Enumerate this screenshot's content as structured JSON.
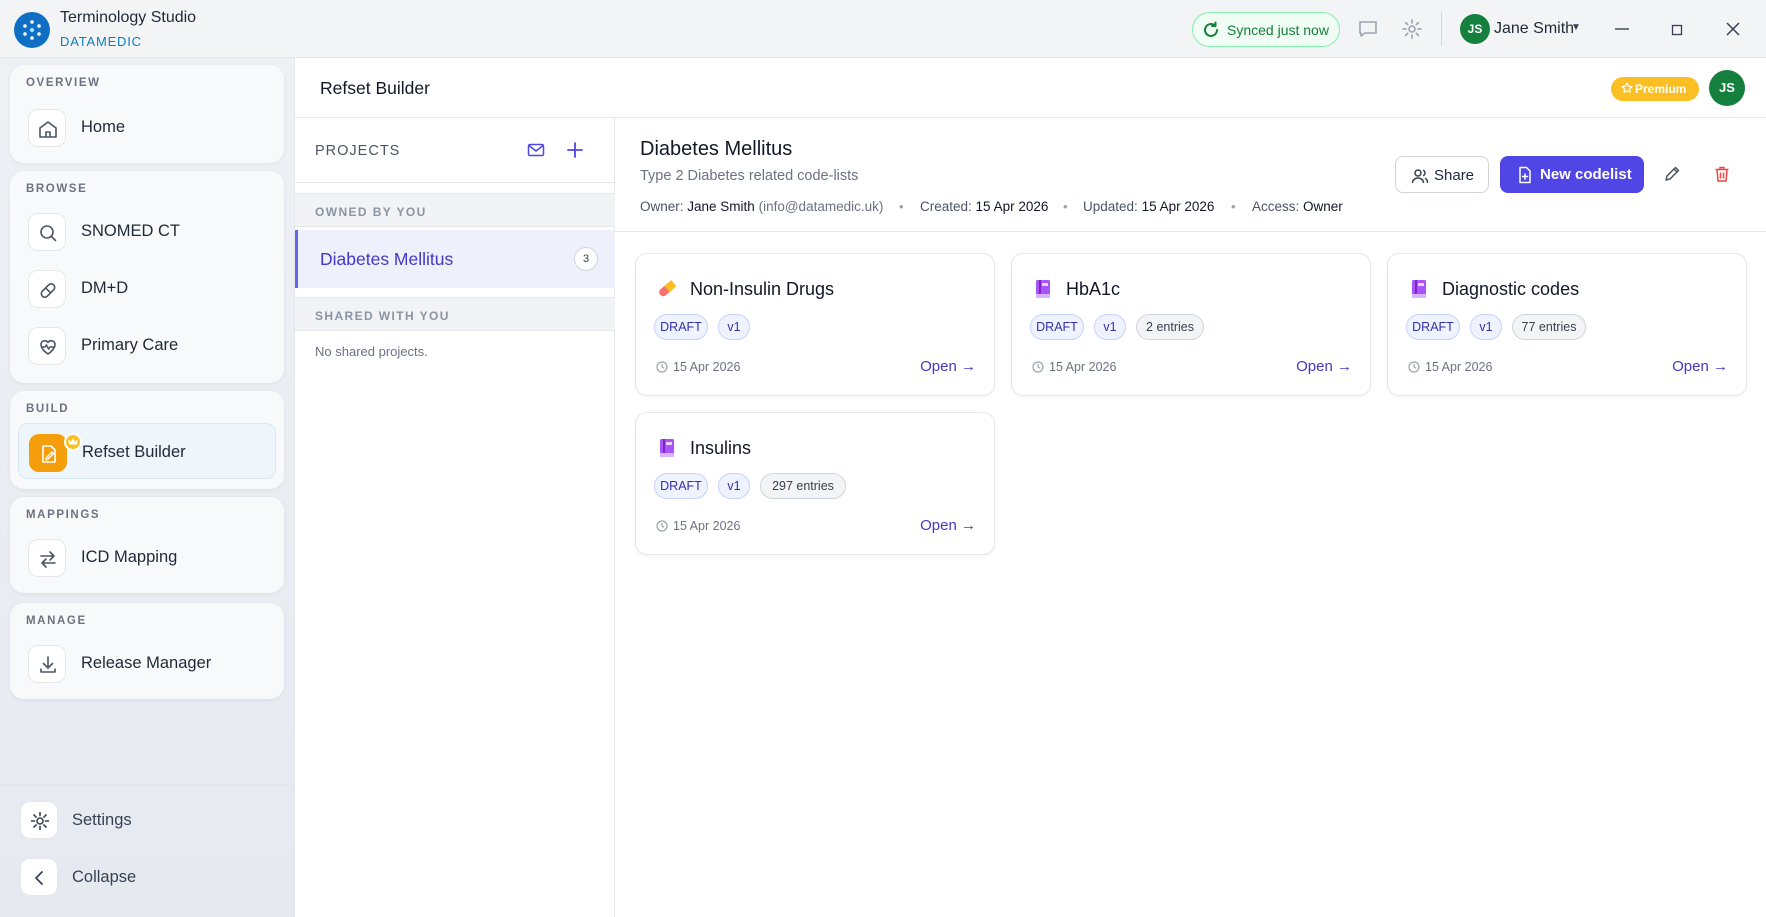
{
  "app": {
    "title": "Terminology Studio",
    "subtitle": "DATAMEDIC",
    "sync_status": "Synced just now",
    "user_initials": "JS",
    "user_name": "Jane Smith"
  },
  "sidebar": {
    "groups": [
      {
        "title": "OVERVIEW",
        "items": [
          {
            "label": "Home",
            "icon": "home-icon"
          }
        ]
      },
      {
        "title": "BROWSE",
        "items": [
          {
            "label": "SNOMED CT",
            "icon": "search-icon"
          },
          {
            "label": "DM+D",
            "icon": "pill-icon"
          },
          {
            "label": "Primary Care",
            "icon": "heart-pulse-icon"
          }
        ]
      },
      {
        "title": "BUILD",
        "items": [
          {
            "label": "Refset Builder",
            "icon": "edit-file-icon",
            "active": true
          }
        ]
      },
      {
        "title": "MAPPINGS",
        "items": [
          {
            "label": "ICD Mapping",
            "icon": "swap-arrows-icon"
          }
        ]
      },
      {
        "title": "MANAGE",
        "items": [
          {
            "label": "Release Manager",
            "icon": "download-icon"
          }
        ]
      }
    ],
    "bottom": {
      "settings_label": "Settings",
      "collapse_label": "Collapse"
    }
  },
  "header": {
    "page_title": "Refset Builder",
    "premium_label": "Premium",
    "avatar_initials": "JS"
  },
  "projects": {
    "title": "PROJECTS",
    "owned_heading": "OWNED BY YOU",
    "owned": [
      {
        "name": "Diabetes Mellitus",
        "count": "3"
      }
    ],
    "shared_heading": "SHARED WITH YOU",
    "shared_empty": "No shared projects."
  },
  "project": {
    "title": "Diabetes Mellitus",
    "description": "Type 2 Diabetes related code-lists",
    "owner_label": "Owner:",
    "owner_name": "Jane Smith",
    "owner_email": "(info@datamedic.uk)",
    "created_label": "Created:",
    "created": "15 Apr 2026",
    "updated_label": "Updated:",
    "updated": "15 Apr 2026",
    "access_label": "Access:",
    "access": "Owner",
    "share_label": "Share",
    "new_codelist_label": "New codelist"
  },
  "codelists": [
    {
      "title": "Non-Insulin Drugs",
      "icon": "pill-capsule-icon",
      "status": "DRAFT",
      "version": "v1",
      "entries": "",
      "date": "15 Apr 2026",
      "open_label": "Open →"
    },
    {
      "title": "HbA1c",
      "icon": "book-icon",
      "status": "DRAFT",
      "version": "v1",
      "entries": "2 entries",
      "date": "15 Apr 2026",
      "open_label": "Open →"
    },
    {
      "title": "Diagnostic codes",
      "icon": "book-icon",
      "status": "DRAFT",
      "version": "v1",
      "entries": "77 entries",
      "date": "15 Apr 2026",
      "open_label": "Open →"
    },
    {
      "title": "Insulins",
      "icon": "book-icon",
      "status": "DRAFT",
      "version": "v1",
      "entries": "297 entries",
      "date": "15 Apr 2026",
      "open_label": "Open →"
    }
  ],
  "colors": {
    "accent": "#4f46e5",
    "sync_green": "#15803d",
    "premium": "#fbbf24",
    "delete_red": "#ef4444",
    "brand_blue": "#0e6fc4"
  }
}
